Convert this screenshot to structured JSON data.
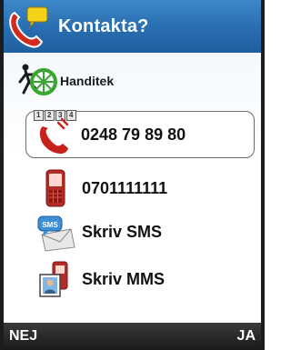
{
  "header": {
    "title": "Kontakta?",
    "icon": "phone-chat-icon"
  },
  "company": {
    "name": "Handitek",
    "icon": "handitek-logo"
  },
  "options": [
    {
      "label": "0248 79 89 80",
      "icon": "landline-phone-icon",
      "selected": true,
      "badge": [
        "1",
        "2",
        "3",
        "4"
      ]
    },
    {
      "label": "0701111111",
      "icon": "mobile-phone-icon",
      "selected": false
    },
    {
      "label": "Skriv SMS",
      "icon": "sms-icon",
      "selected": false
    },
    {
      "label": "Skriv MMS",
      "icon": "mms-icon",
      "selected": false
    }
  ],
  "softkeys": {
    "left": "NEJ",
    "right": "JA"
  },
  "colors": {
    "header": "#2a6fb2",
    "phone_red": "#c8201b",
    "footer": "#1a1a1a"
  }
}
